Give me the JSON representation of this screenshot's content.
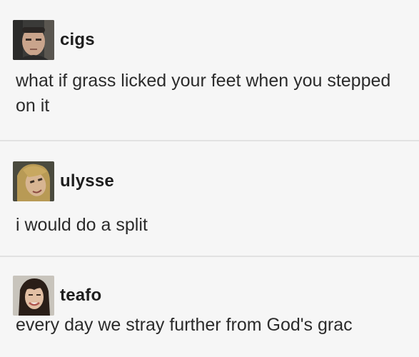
{
  "posts": [
    {
      "username": "cigs",
      "avatar_icon": "user-avatar-man",
      "text": "what if grass licked your feet when you stepped on it"
    },
    {
      "username": "ulysse",
      "avatar_icon": "user-avatar-woman",
      "text": "i would do a split"
    },
    {
      "username": "teafo",
      "avatar_icon": "user-avatar-woman",
      "text": "every day we stray further from God's grac"
    }
  ]
}
